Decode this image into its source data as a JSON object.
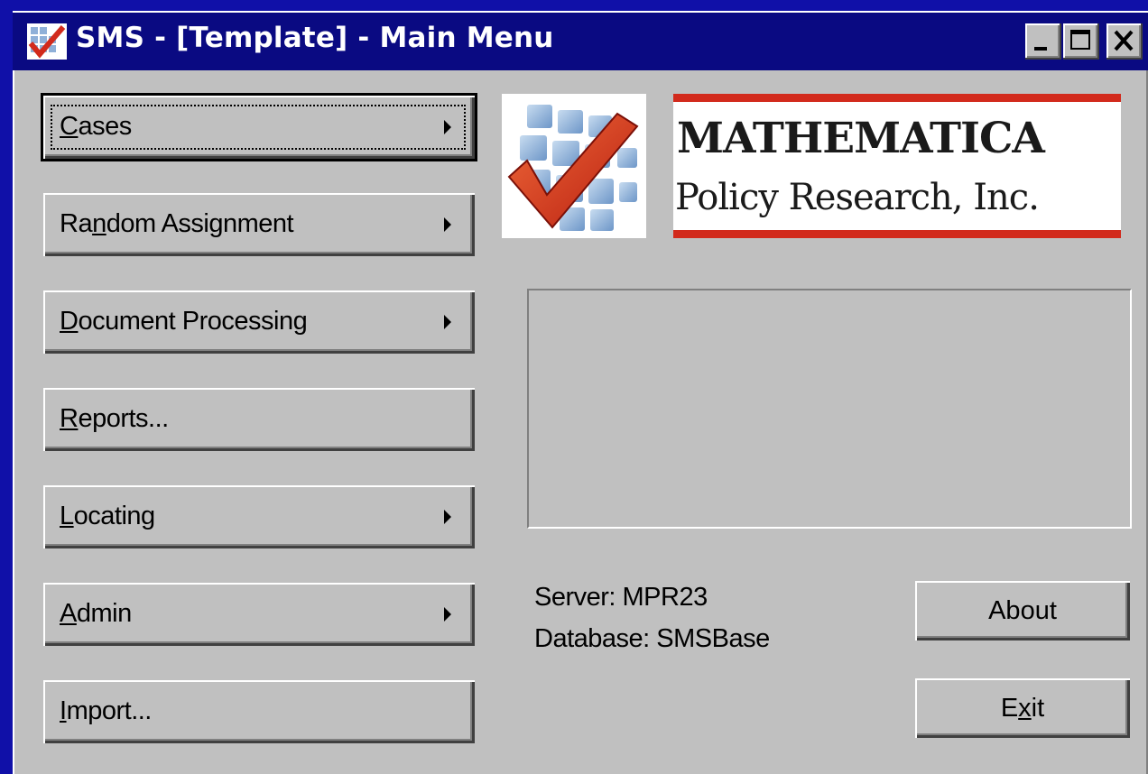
{
  "window": {
    "title": "SMS - [Template] - Main Menu",
    "controls": {
      "minimize": "_",
      "maximize": "□",
      "close": "×"
    }
  },
  "menu_buttons": [
    {
      "pre": "",
      "ul": "C",
      "post": "ases",
      "submenu": true
    },
    {
      "pre": "Ra",
      "ul": "n",
      "post": "dom Assignment",
      "submenu": true
    },
    {
      "pre": "",
      "ul": "D",
      "post": "ocument Processing",
      "submenu": true
    },
    {
      "pre": "",
      "ul": "R",
      "post": "eports...",
      "submenu": false
    },
    {
      "pre": "",
      "ul": "L",
      "post": "ocating",
      "submenu": true
    },
    {
      "pre": "",
      "ul": "A",
      "post": "dmin",
      "submenu": true
    },
    {
      "pre": "",
      "ul": "I",
      "post": "mport...",
      "submenu": false
    }
  ],
  "logo": {
    "icon": "checkmark-grid-logo",
    "wordmark_line1": "MATHEMATICA",
    "wordmark_line2": "Policy Research, Inc.",
    "accent_color": "#d22a1c"
  },
  "status": {
    "server": "Server: MPR23",
    "database": "Database: SMSBase"
  },
  "side_buttons": {
    "about": "About",
    "exit_pre": "E",
    "exit_ul": "x",
    "exit_post": "it"
  },
  "colors": {
    "desktop": "#1010a8",
    "titlebar": "#0a0a82",
    "face": "#c0c0c0"
  }
}
